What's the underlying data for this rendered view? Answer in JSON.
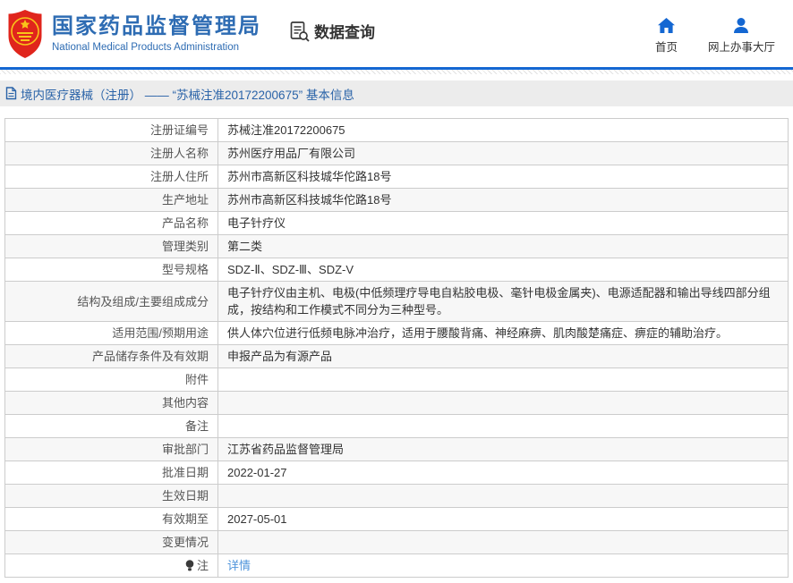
{
  "header": {
    "org_name_cn": "国家药品监督管理局",
    "org_name_en": "National Medical Products Administration",
    "nav_data_query": "数据查询",
    "nav_home": "首页",
    "nav_online_hall": "网上办事大厅"
  },
  "breadcrumb": {
    "text": "境内医疗器械（注册） —— “苏械注准20172200675” 基本信息"
  },
  "table": {
    "rows": [
      {
        "label": "注册证编号",
        "value": "苏械注准20172200675"
      },
      {
        "label": "注册人名称",
        "value": "苏州医疗用品厂有限公司"
      },
      {
        "label": "注册人住所",
        "value": "苏州市高新区科技城华佗路18号"
      },
      {
        "label": "生产地址",
        "value": "苏州市高新区科技城华佗路18号"
      },
      {
        "label": "产品名称",
        "value": "电子针疗仪"
      },
      {
        "label": "管理类别",
        "value": "第二类"
      },
      {
        "label": "型号规格",
        "value": "SDZ-Ⅱ、SDZ-Ⅲ、SDZ-V"
      },
      {
        "label": "结构及组成/主要组成成分",
        "value": "电子针疗仪由主机、电极(中低频理疗导电自粘胶电极、毫针电极金属夹)、电源适配器和输出导线四部分组成，按结构和工作模式不同分为三种型号。"
      },
      {
        "label": "适用范围/预期用途",
        "value": "供人体穴位进行低频电脉冲治疗，适用于腰酸背痛、神经麻痹、肌肉酸楚痛症、痹症的辅助治疗。"
      },
      {
        "label": "产品储存条件及有效期",
        "value": "申报产品为有源产品"
      },
      {
        "label": "附件",
        "value": ""
      },
      {
        "label": "其他内容",
        "value": ""
      },
      {
        "label": "备注",
        "value": ""
      },
      {
        "label": "审批部门",
        "value": "江苏省药品监督管理局"
      },
      {
        "label": "批准日期",
        "value": "2022-01-27"
      },
      {
        "label": "生效日期",
        "value": ""
      },
      {
        "label": "有效期至",
        "value": "2027-05-01"
      },
      {
        "label": "变更情况",
        "value": ""
      },
      {
        "label": "注",
        "value": "详情",
        "link": true,
        "label_icon": "bulb"
      }
    ]
  },
  "colors": {
    "accent_blue": "#1467d2",
    "brand_text_blue": "#2e6cb3",
    "breadcrumb_blue": "#2a63a8",
    "link_blue": "#4f94db",
    "emblem_red": "#e0251c",
    "emblem_gold": "#f9c41a",
    "alt_row_bg": "#f7f7f7",
    "border_gray": "#cccccc"
  }
}
